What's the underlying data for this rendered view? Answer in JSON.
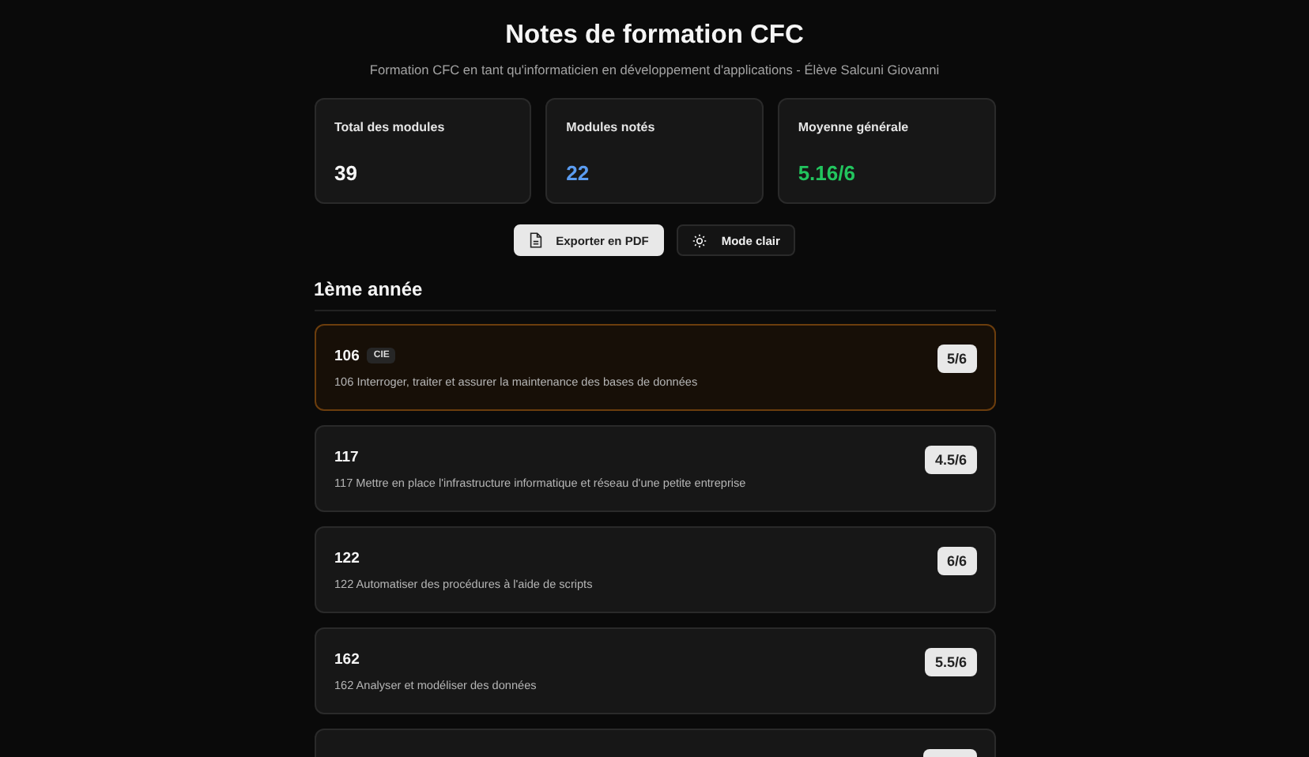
{
  "header": {
    "title": "Notes de formation CFC",
    "subtitle": "Formation CFC en tant qu'informaticien en développement d'applications - Élève Salcuni Giovanni"
  },
  "stats": [
    {
      "label": "Total des modules",
      "value": "39",
      "color": "#f5f5f5"
    },
    {
      "label": "Modules notés",
      "value": "22",
      "color": "#5b9cf0"
    },
    {
      "label": "Moyenne générale",
      "value": "5.16/6",
      "color": "#22c55e"
    }
  ],
  "actions": [
    {
      "kind": "export",
      "label": "Exporter en PDF",
      "selected": true
    },
    {
      "kind": "theme",
      "label": "Mode clair",
      "selected": false
    }
  ],
  "section": {
    "title": "1ème année",
    "modules": [
      {
        "number": "106",
        "tag": "CIE",
        "name": "106 Interroger, traiter et assurer la maintenance des bases de données",
        "grade": "5/6",
        "highlighted": true
      },
      {
        "number": "117",
        "name": "117 Mettre en place l'infrastructure informatique et réseau d'une petite entreprise",
        "grade": "4.5/6",
        "highlighted": false
      },
      {
        "number": "122",
        "name": "122 Automatiser des procédures à l'aide de scripts",
        "grade": "6/6",
        "highlighted": false
      },
      {
        "number": "162",
        "name": "162 Analyser et modéliser des données",
        "grade": "5.5/6",
        "highlighted": false
      },
      {
        "highlighted": false
      }
    ]
  }
}
